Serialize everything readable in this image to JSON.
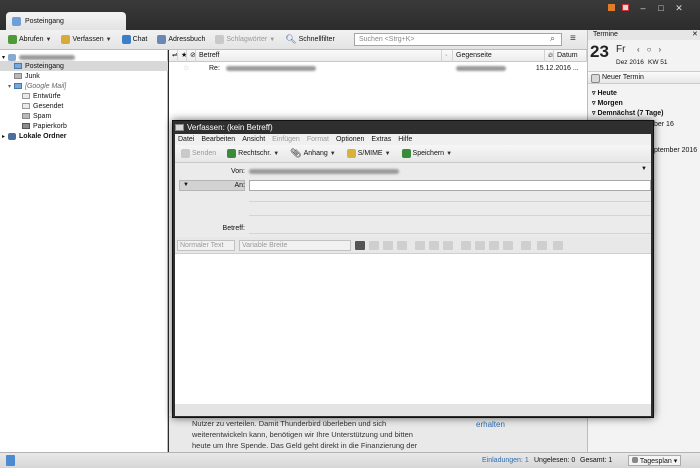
{
  "main_tab": {
    "label": "Posteingang"
  },
  "toolbar": {
    "fetch": "Abrufen",
    "compose": "Verfassen",
    "chat": "Chat",
    "address_book": "Adressbuch",
    "tag": "Schlagwörter",
    "quick_filter": "Schnellfilter"
  },
  "search": {
    "placeholder": "Suchen <Strg+K>"
  },
  "folders": {
    "inbox": "Posteingang",
    "junk": "Junk",
    "gmail": "[Google Mail]",
    "drafts": "Entwürfe",
    "sent": "Gesendet",
    "spam": "Spam",
    "trash": "Papierkorb",
    "local": "Lokale Ordner"
  },
  "thread": {
    "columns": {
      "subject": "Betreff",
      "correspondent": "Gegenseite",
      "date": "Datum"
    },
    "rows": [
      {
        "subject_prefix": "Re:",
        "date": "15.12.2016 ..."
      }
    ]
  },
  "background_body": {
    "line1": "Nutzer zu verteilen. Damit Thunderbird überleben und sich",
    "line2": "weiterentwickeln kann, benötigen wir Ihre Unterstützung und bitten",
    "line3": "heute um Ihre Spende. Das Geld geht direkt in die Finanzierung der",
    "link": "erhalten"
  },
  "today_pane": {
    "title": "Termine",
    "day": "23",
    "weekday": "Fr",
    "month": "Dez 2016",
    "week": "KW 51",
    "new_event": "Neuer Termin",
    "today": "Heute",
    "tomorrow": "Morgen",
    "upcoming": "Demnächst (7 Tage)",
    "event1": "ber 16",
    "event2": "ptember 2016"
  },
  "statusbar": {
    "invitations": "Einladungen: 1",
    "unread": "Ungelesen: 0",
    "total": "Gesamt: 1",
    "day_plan": "Tagesplan"
  },
  "compose": {
    "title": "Verfassen: (kein Betreff)",
    "menu": [
      "Datei",
      "Bearbeiten",
      "Ansicht",
      "Einfügen",
      "Format",
      "Optionen",
      "Extras",
      "Hilfe"
    ],
    "toolbar": {
      "send": "Senden",
      "spell": "Rechtschr.",
      "attach": "Anhang",
      "smime": "S/MIME",
      "save": "Speichern"
    },
    "from_label": "Von:",
    "to_label": "An:",
    "subject_label": "Betreff:",
    "format_paragraph": "Normaler Text",
    "format_font": "Variable Breite"
  },
  "colors": {
    "accent_link": "#2a6fb5",
    "compose_frame": "#2f2f2f",
    "titlebar": "#2c2c2c"
  }
}
